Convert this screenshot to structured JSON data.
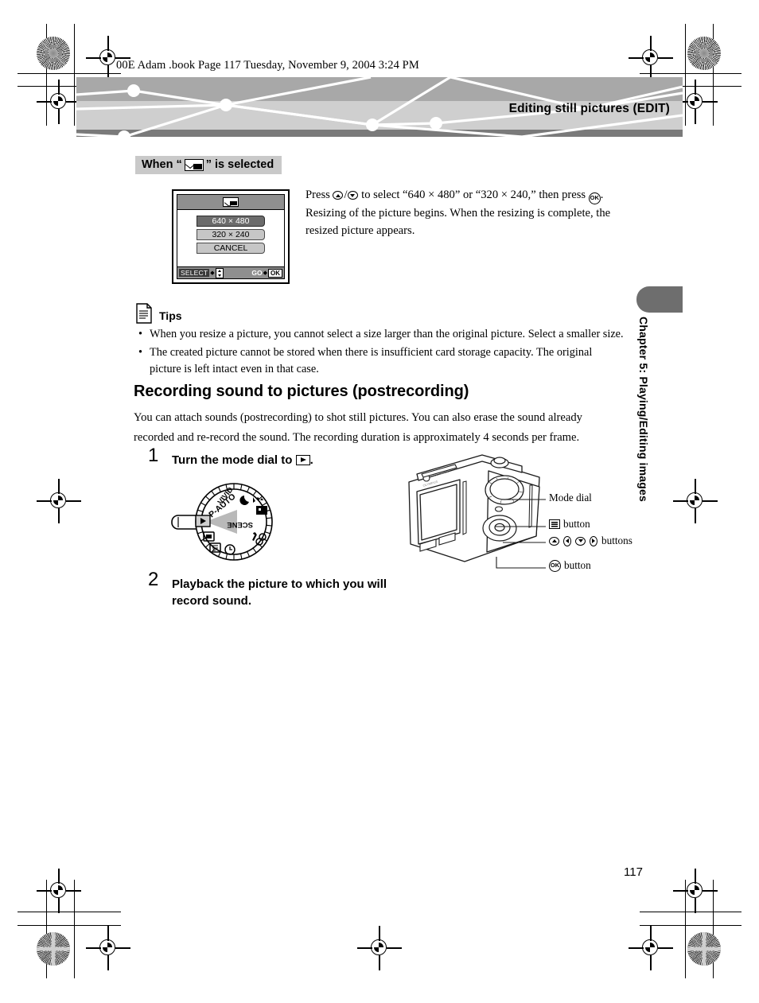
{
  "print_marks": {
    "file_stamp": "00E Adam .book  Page 117  Tuesday, November 9, 2004  3:24 PM",
    "page_number": "117"
  },
  "banner": {
    "title": "Editing still pictures (EDIT)"
  },
  "chapter_tab": {
    "label": "Chapter 5: Playing/Editing images"
  },
  "section_label": {
    "prefix": "When “",
    "icon": "resize-icon",
    "suffix": "” is selected"
  },
  "lcd": {
    "title_icon": "resize-icon",
    "menu": [
      {
        "label": "640 × 480",
        "selected": true
      },
      {
        "label": "320 × 240",
        "selected": false
      },
      {
        "label": "CANCEL",
        "selected": false
      }
    ],
    "status_left": "SELECT",
    "status_right": "GO",
    "status_ok": "OK"
  },
  "lcd_caption": "Press ⌃/⌄ to select “640 × 480” or “320 × 240,” then press ⒪. Resizing of the picture begins. When the resizing is complete, the resized picture appears.",
  "tips": {
    "icon": "note-icon",
    "title": "Tips",
    "items": [
      "When you resize a picture, you cannot select a size larger than the original picture. Select a smaller size.",
      "The created picture cannot be stored when there is insufficient card storage capacity. The original picture is left intact even in that case."
    ]
  },
  "section": {
    "title": "Recording sound to pictures (postrecording)",
    "body": "You can attach sounds (postrecording) to shot still pictures. You can also erase the sound already recorded and re-record the sound. The recording duration is approximately 4 seconds per frame."
  },
  "steps": [
    {
      "number": "1",
      "text_before": "Turn the mode dial to ",
      "icon": "playback-icon",
      "text_after": "."
    },
    {
      "number": "2",
      "text_before": "Playback the picture to which you will record sound.",
      "icon": "",
      "text_after": ""
    }
  ],
  "mode_dial": {
    "labels": [
      "VIVID",
      "P-AUTO",
      "SCENE"
    ],
    "selected_icon": "playback-icon"
  },
  "camera_callouts": [
    {
      "icon": "",
      "label": "Mode dial"
    },
    {
      "icon": "menu-icon",
      "label": "button"
    },
    {
      "icon": "arrow-buttons-icon",
      "label": "buttons"
    },
    {
      "icon": "ok-icon",
      "label": "button"
    }
  ],
  "camera_brand": "OLYMPUS",
  "colors": {
    "banner_top": "#a8a8a8",
    "banner_mid": "#cfcfcf",
    "banner_bottom": "#7a7a7a",
    "tab_gray": "#6e6e6e",
    "label_gray": "#c9c9c9",
    "lcd_bar": "#8f8f8f",
    "menu_selected": "#6b6b6b",
    "menu_normal": "#c6c6c6"
  }
}
